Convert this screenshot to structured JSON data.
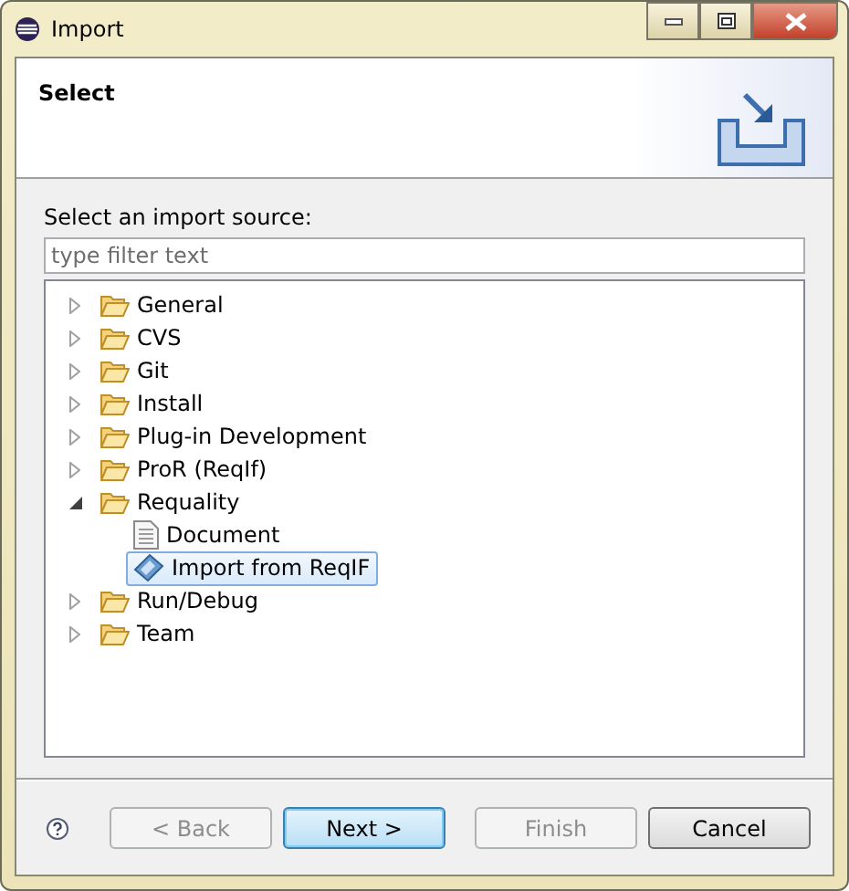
{
  "window": {
    "title": "Import"
  },
  "header": {
    "title": "Select"
  },
  "filter": {
    "label": "Select an import source:",
    "placeholder": "type filter text"
  },
  "tree": [
    {
      "label": "General",
      "kind": "folder",
      "expanded": false,
      "selected": false
    },
    {
      "label": "CVS",
      "kind": "folder",
      "expanded": false,
      "selected": false
    },
    {
      "label": "Git",
      "kind": "folder",
      "expanded": false,
      "selected": false
    },
    {
      "label": "Install",
      "kind": "folder",
      "expanded": false,
      "selected": false
    },
    {
      "label": "Plug-in Development",
      "kind": "folder",
      "expanded": false,
      "selected": false
    },
    {
      "label": "ProR (ReqIf)",
      "kind": "folder",
      "expanded": false,
      "selected": false
    },
    {
      "label": "Requality",
      "kind": "folder",
      "expanded": true,
      "selected": false,
      "children": [
        {
          "label": "Document",
          "kind": "document",
          "selected": false
        },
        {
          "label": "Import from ReqIF",
          "kind": "import",
          "selected": true
        }
      ]
    },
    {
      "label": "Run/Debug",
      "kind": "folder",
      "expanded": false,
      "selected": false
    },
    {
      "label": "Team",
      "kind": "folder",
      "expanded": false,
      "selected": false
    }
  ],
  "buttons": [
    {
      "label": "< Back",
      "disabled": true,
      "default": false
    },
    {
      "label": "Next >",
      "disabled": false,
      "default": true
    },
    {
      "label": "Finish",
      "disabled": true,
      "default": false
    },
    {
      "label": "Cancel",
      "disabled": false,
      "default": false
    }
  ]
}
